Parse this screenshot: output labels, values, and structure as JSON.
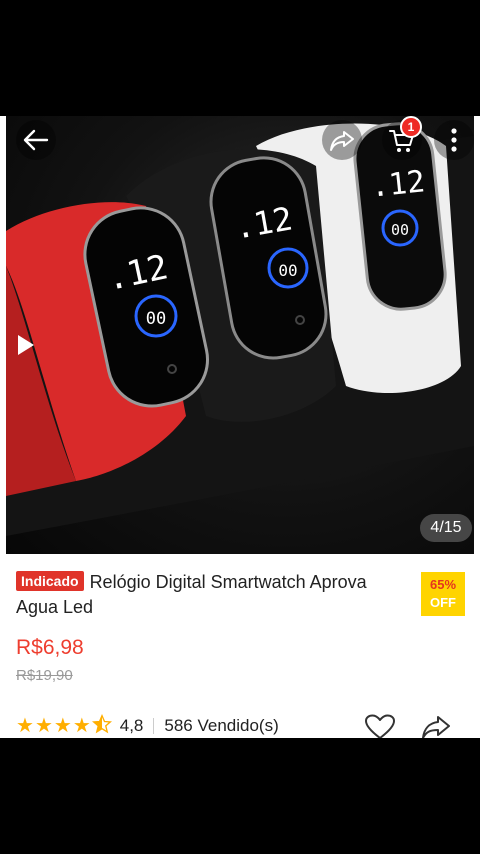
{
  "header": {
    "back_icon": "arrow-left-icon",
    "share_icon": "share-icon",
    "cart_icon": "cart-icon",
    "cart_badge": "1",
    "more_icon": "more-vertical-icon"
  },
  "gallery": {
    "counter": "4/15",
    "play_icon": "play-icon",
    "watch_times": [
      "12",
      "12",
      "12"
    ],
    "watch_colors": [
      "#d92a2a",
      "#1b1b1b",
      "#f2f2f2"
    ]
  },
  "product": {
    "tag": "Indicado",
    "title": "Relógio Digital Smartwatch Aprova Agua Led",
    "discount_line1": "65%",
    "discount_line2": "OFF",
    "price": "R$6,98",
    "old_price": "R$19,90",
    "rating": "4,8",
    "rating_stars": 4.5,
    "sold": "586 Vendido(s)"
  },
  "colors": {
    "accent": "#ee3e2f",
    "star": "#ffae00",
    "tag_bg": "#e0342a",
    "discount_bg": "#ffd400"
  }
}
